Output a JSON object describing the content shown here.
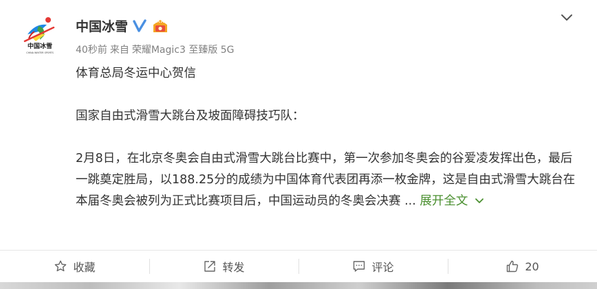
{
  "post": {
    "author": "中国冰雪",
    "logo_text": "中国冰雪",
    "logo_subtext": "CHINA WINTER SPORTS",
    "meta": {
      "time": "40秒前",
      "source_prefix": "来自",
      "device": "荣耀Magic3 至臻版 5G"
    },
    "paragraphs": [
      "体育总局冬运中心贺信",
      "国家自由式滑雪大跳台及坡面障碍技巧队：",
      "2月8日，在北京冬奥会自由式滑雪大跳台比赛中，第一次参加冬奥会的谷爱凌发挥出色，最后一跳奠定胜局，以188.25分的成绩为中国体育代表团再添一枚金牌，这是自由式滑雪大跳台在本届冬奥会被列为正式比赛项目后，中国运动员的冬奥会决赛"
    ],
    "ellipsis": " ... ",
    "expand_label": "展开全文"
  },
  "actions": {
    "favorite_label": "收藏",
    "repost_label": "转发",
    "comment_label": "评论",
    "like_count": "20"
  },
  "colors": {
    "accent_green": "#4a8f2f",
    "verified_blue": "#4a90e2",
    "meta_gray": "#808080"
  },
  "icons": [
    "avatar-logo",
    "verified-icon",
    "vip-badge-icon",
    "chevron-down-icon",
    "star-icon",
    "repost-icon",
    "comment-icon",
    "like-icon"
  ]
}
